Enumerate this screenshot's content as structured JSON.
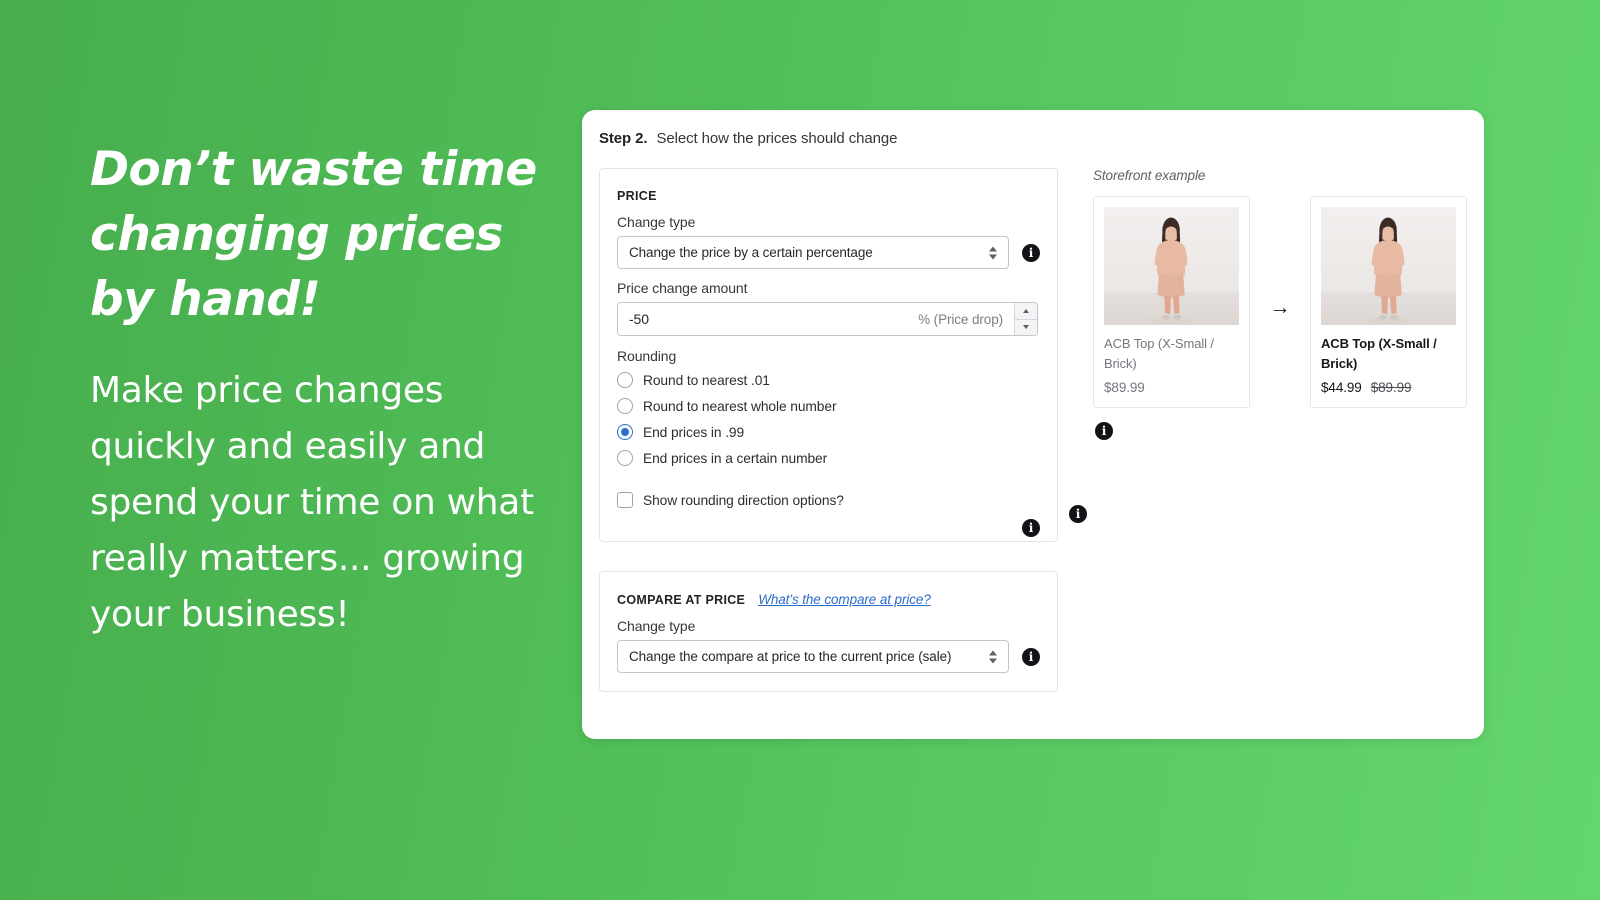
{
  "marketing": {
    "headline": "Don’t waste time changing prices by hand!",
    "subcopy": "Make price changes quickly and easily and spend your time on what really matters... growing your business!"
  },
  "panel": {
    "step_label": "Step 2.",
    "step_description": "Select how the prices should change"
  },
  "price_section": {
    "title": "PRICE",
    "change_type_label": "Change type",
    "change_type_value": "Change the price by a certain percentage",
    "amount_label": "Price change amount",
    "amount_value": "-50",
    "amount_suffix": "% (Price drop)",
    "rounding_label": "Rounding",
    "rounding_options": [
      {
        "label": "Round to nearest .01",
        "selected": false
      },
      {
        "label": "Round to nearest whole number",
        "selected": false
      },
      {
        "label": "End prices in .99",
        "selected": true
      },
      {
        "label": "End prices in a certain number",
        "selected": false
      }
    ],
    "show_rounding_direction_label": "Show rounding direction options?",
    "show_rounding_direction_checked": false
  },
  "compare_section": {
    "title": "COMPARE AT PRICE",
    "help_link": "What’s the compare at price?",
    "change_type_label": "Change type",
    "change_type_value": "Change the compare at price to the current price (sale)"
  },
  "storefront": {
    "title": "Storefront example",
    "arrow": "→",
    "before": {
      "product_name": "ACB Top (X-Small / Brick)",
      "price": "$89.99"
    },
    "after": {
      "product_name": "ACB Top (X-Small / Brick)",
      "price": "$44.99",
      "compare_at_price": "$89.99"
    }
  },
  "icons": {
    "info": "i"
  },
  "colors": {
    "accent_blue": "#2c6ecb",
    "background_green_start": "#47ad4e",
    "background_green_end": "#63d66d"
  }
}
